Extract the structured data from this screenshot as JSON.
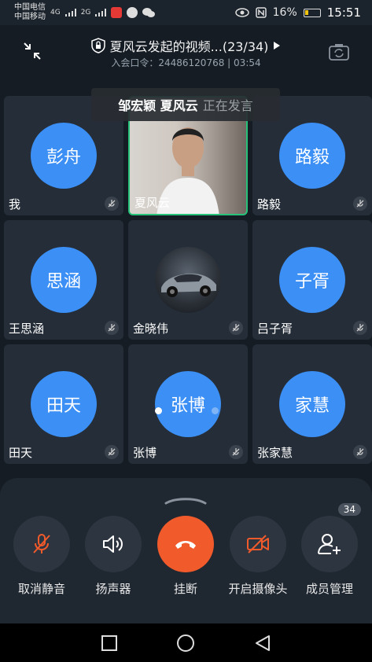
{
  "status_bar": {
    "carrier1": "中国电信",
    "carrier2": "中国移动",
    "signal1": "4G",
    "signal2": "2G",
    "battery": "16%",
    "time": "15:51"
  },
  "header": {
    "title": "夏风云发起的视频...(23/34)",
    "meeting_label": "入会口令：",
    "meeting_code": "24486120768",
    "separator": "|",
    "duration": "03:54"
  },
  "speaking_banner": {
    "names": "邹宏颖 夏风云",
    "status": "正在发言"
  },
  "participants": [
    {
      "avatar_text": "彭舟",
      "name": "我",
      "type": "avatar"
    },
    {
      "avatar_text": "",
      "name": "夏风云",
      "type": "video"
    },
    {
      "avatar_text": "路毅",
      "name": "路毅",
      "type": "avatar"
    },
    {
      "avatar_text": "思涵",
      "name": "王思涵",
      "type": "avatar"
    },
    {
      "avatar_text": "",
      "name": "金晓伟",
      "type": "photo"
    },
    {
      "avatar_text": "子胥",
      "name": "吕子胥",
      "type": "avatar"
    },
    {
      "avatar_text": "田天",
      "name": "田天",
      "type": "avatar"
    },
    {
      "avatar_text": "张博",
      "name": "张博",
      "type": "avatar"
    },
    {
      "avatar_text": "家慧",
      "name": "张家慧",
      "type": "avatar"
    }
  ],
  "controls": [
    {
      "label": "取消静音",
      "icon": "mic-muted-icon"
    },
    {
      "label": "扬声器",
      "icon": "speaker-icon"
    },
    {
      "label": "挂断",
      "icon": "hangup-icon"
    },
    {
      "label": "开启摄像头",
      "icon": "camera-off-icon"
    },
    {
      "label": "成员管理",
      "icon": "add-member-icon",
      "badge": "34"
    }
  ],
  "colors": {
    "avatar_blue": "#3b8ff5",
    "hangup_orange": "#f15a2b",
    "active_speaker_green": "#27c27a",
    "muted_icon_orange": "#f15a2b"
  }
}
